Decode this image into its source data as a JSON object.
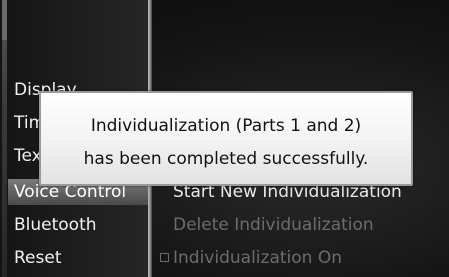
{
  "menu": {
    "items": [
      {
        "label": "Display"
      },
      {
        "label": "Time"
      },
      {
        "label": "Text Reader"
      },
      {
        "label": "Voice Control"
      },
      {
        "label": "Bluetooth"
      },
      {
        "label": "Reset"
      }
    ],
    "selected_index": 3
  },
  "options": {
    "items": [
      {
        "label": "Start New Individualization",
        "state": "active"
      },
      {
        "label": "Delete Individualization",
        "state": "disabled"
      },
      {
        "label": "Individualization On",
        "state": "disabled",
        "checked": false
      }
    ]
  },
  "dialog": {
    "line1": "Individualization (Parts 1 and 2)",
    "line2": "has been completed successfully."
  }
}
